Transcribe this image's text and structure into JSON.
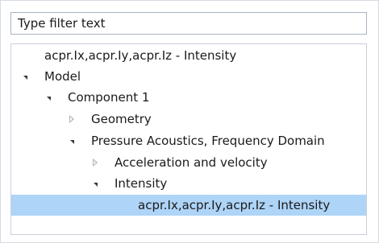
{
  "filter": {
    "placeholder": "Type filter text"
  },
  "tree": {
    "items": [
      {
        "label": "acpr.Ix,acpr.Iy,acpr.Iz - Intensity"
      },
      {
        "label": "Model",
        "toggle": "expanded"
      },
      {
        "label": "Component 1",
        "toggle": "expanded"
      },
      {
        "label": "Geometry",
        "toggle": "collapsed"
      },
      {
        "label": "Pressure Acoustics, Frequency Domain",
        "toggle": "expanded"
      },
      {
        "label": "Acceleration and velocity",
        "toggle": "collapsed"
      },
      {
        "label": "Intensity",
        "toggle": "expanded"
      },
      {
        "label": "acpr.Ix,acpr.Iy,acpr.Iz - Intensity",
        "selected": true
      }
    ]
  },
  "colors": {
    "selection": "#aed4f7",
    "border": "#a9b4c2"
  }
}
